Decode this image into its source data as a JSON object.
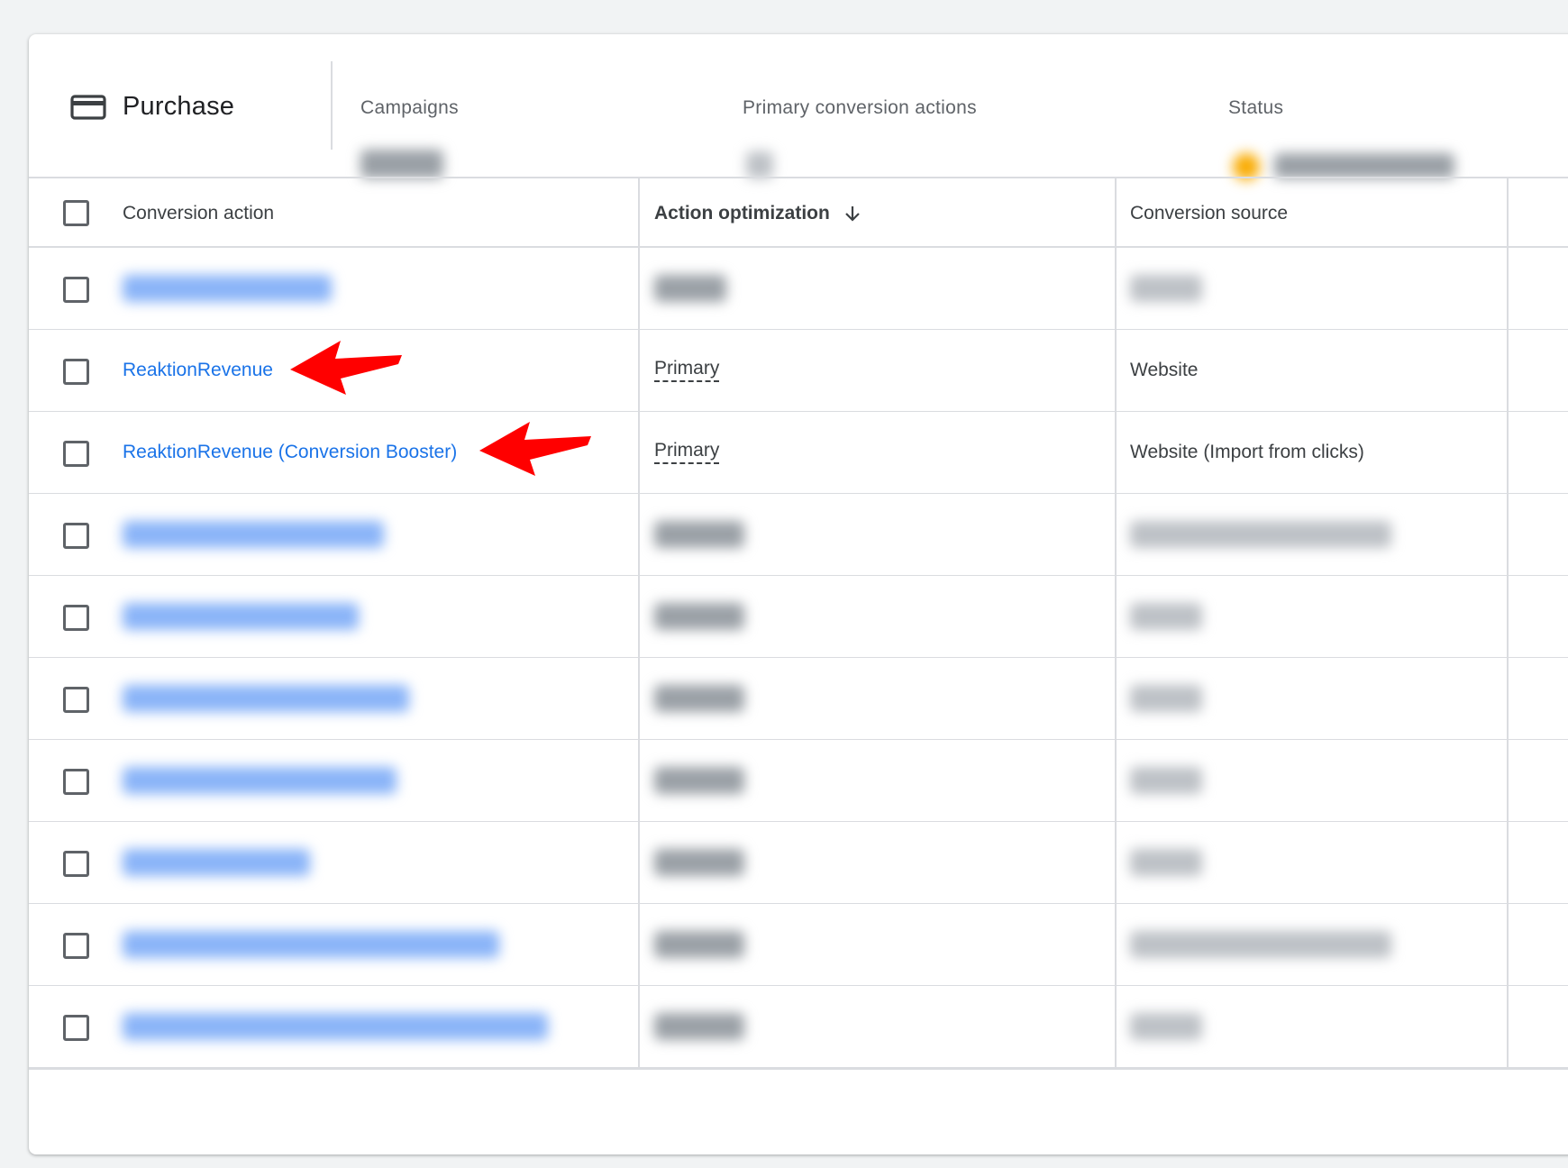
{
  "summary": {
    "goal_icon": "credit-card-icon",
    "goal_title": "Purchase",
    "metrics": [
      {
        "label": "Campaigns"
      },
      {
        "label": "Primary conversion actions"
      },
      {
        "label": "Status"
      }
    ]
  },
  "table": {
    "headers": {
      "conversion_action": "Conversion action",
      "action_optimization": "Action optimization",
      "conversion_source": "Conversion source"
    },
    "sort_icon": "arrow-down-icon",
    "rows": [
      {
        "action": "",
        "optimization": "",
        "source": "",
        "blurred": true
      },
      {
        "action": "ReaktionRevenue",
        "optimization": "Primary",
        "source": "Website",
        "blurred": false
      },
      {
        "action": "ReaktionRevenue (Conversion Booster)",
        "optimization": "Primary",
        "source": "Website (Import from clicks)",
        "blurred": false
      },
      {
        "action": "",
        "optimization": "",
        "source": "",
        "blurred": true
      },
      {
        "action": "",
        "optimization": "",
        "source": "",
        "blurred": true
      },
      {
        "action": "",
        "optimization": "",
        "source": "",
        "blurred": true
      },
      {
        "action": "",
        "optimization": "",
        "source": "",
        "blurred": true
      },
      {
        "action": "",
        "optimization": "",
        "source": "",
        "blurred": true
      },
      {
        "action": "",
        "optimization": "",
        "source": "",
        "blurred": true
      },
      {
        "action": "",
        "optimization": "",
        "source": "",
        "blurred": true
      }
    ]
  },
  "annotations": {
    "arrow_color": "#ff0000",
    "arrow_icon": "red-arrow-annotation"
  },
  "colors": {
    "link": "#1a73e8",
    "border": "#dadce0",
    "status_dot": "#f9ab00"
  }
}
